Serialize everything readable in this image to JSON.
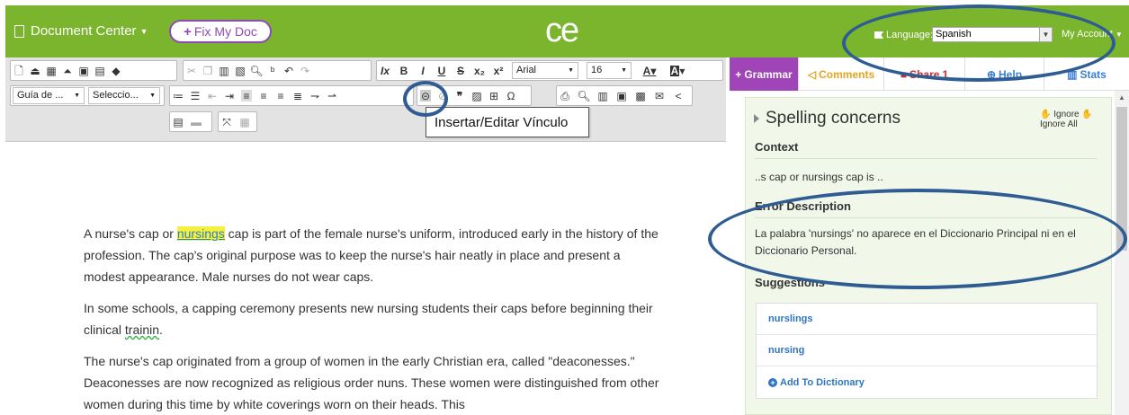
{
  "header": {
    "document_center": "Document Center",
    "fix_my_doc": "Fix My Doc",
    "logo": "ce",
    "language_label": "Language:",
    "language_value": "Spanish",
    "my_account": "My Account"
  },
  "toolbar": {
    "font_name": "Arial",
    "font_size": "16",
    "style_dropdown": "Guía de ...",
    "format_dropdown": "Seleccio...",
    "tooltip": "Insertar/Editar Vínculo",
    "text_color_label": "A",
    "bg_color_label": "A"
  },
  "document": {
    "p1_pre": "A nurse's cap or ",
    "p1_error": "nursings",
    "p1_post": " cap is part of the female nurse's uniform, introduced early in the history of the profession. The cap's original purpose was to keep the nurse's hair neatly in place and present a modest appearance. Male nurses do not wear caps.",
    "p2_pre": "In some schools, a capping ceremony presents new nursing students their caps before beginning their clinical ",
    "p2_error": "trainin",
    "p2_post": ".",
    "p3": "The nurse's cap originated from a group of women in the early Christian era, called \"deaconesses.\" Deaconesses are now recognized as religious order nuns. These women were distinguished from other women during this time by white coverings worn on their heads. This"
  },
  "tabs": {
    "grammar": "Grammar",
    "comments": "Comments",
    "share": "Share",
    "share_count": "1",
    "help": "Help",
    "stats": "Stats"
  },
  "panel": {
    "title": "Spelling concerns",
    "ignore": "Ignore",
    "ignore_all": "Ignore All",
    "context_heading": "Context",
    "context_text": "..s cap or nursings cap is ..",
    "error_heading": "Error Description",
    "error_text": "La palabra 'nursings' no aparece en el Diccionario Principal ni en el Diccionario Personal.",
    "suggestions_heading": "Suggestions",
    "suggestions": [
      "nurslings",
      "nursing"
    ],
    "add_to_dictionary": "Add To Dictionary"
  },
  "colors": {
    "header_green": "#7bb52e",
    "grammar_purple": "#9f45b8",
    "annotation_blue": "#2f5c92",
    "link_blue": "#2e75c2",
    "highlight_yellow": "#f5f13a"
  }
}
